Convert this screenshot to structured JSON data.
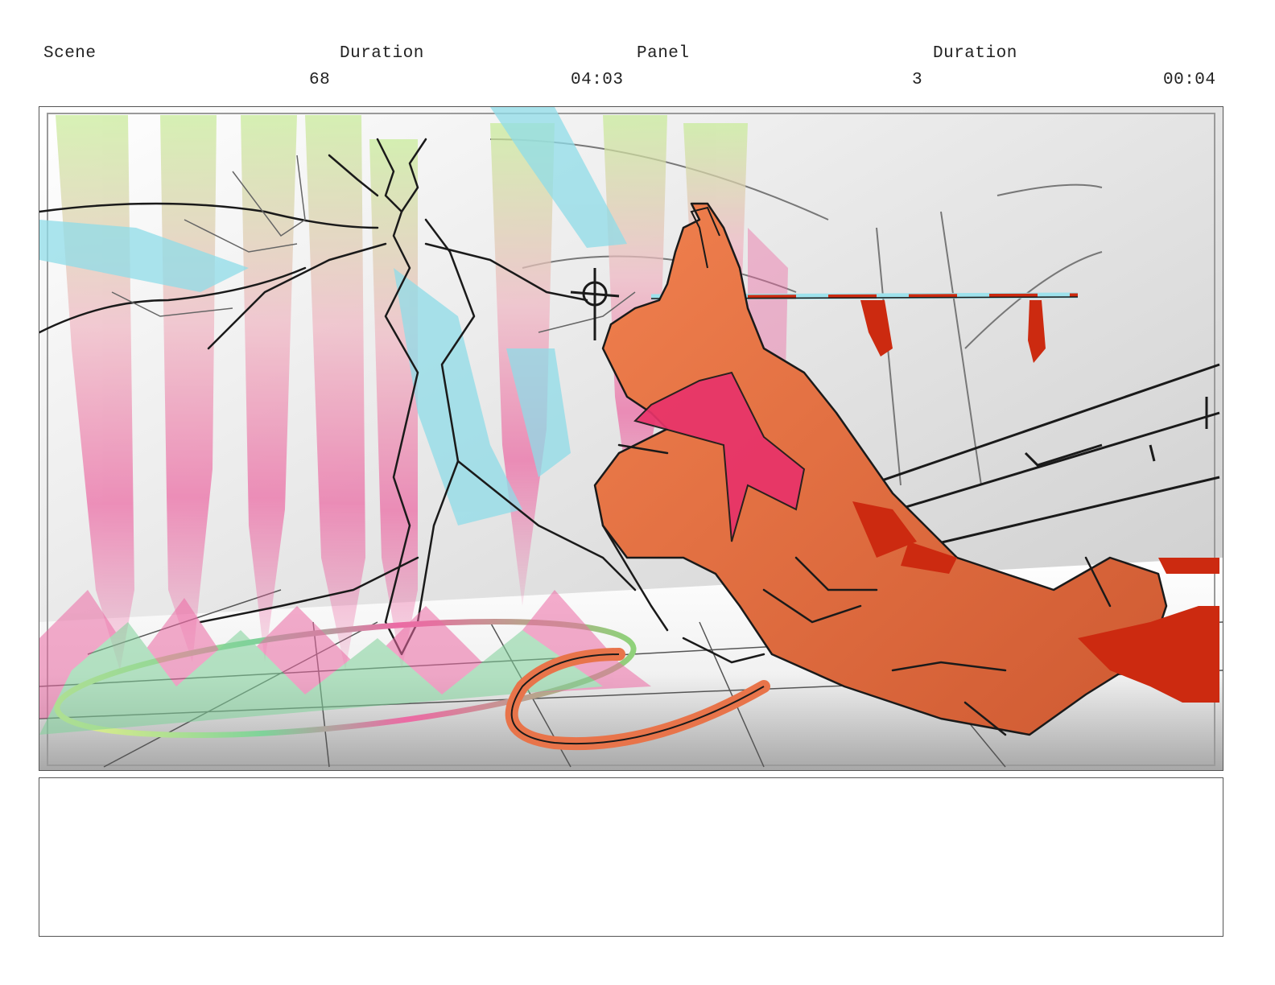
{
  "header": {
    "scene_label": "Scene",
    "scene_duration_label": "Duration",
    "panel_label": "Panel",
    "panel_duration_label": "Duration",
    "scene_number": "68",
    "scene_duration": "04:03",
    "panel_number": "3",
    "panel_duration": "00:04"
  },
  "panel": {
    "illustration": "storyboard-sketch",
    "colors": {
      "horned_figure": "#e8744a",
      "sash": "#e8336a",
      "blood": "#cc2a10",
      "winged_figure": "#9ee2ec",
      "effect_green": "#c8ec98",
      "effect_pink": "#ec6aa4",
      "line": "#1a1a1a"
    }
  },
  "notes": {
    "text": ""
  }
}
